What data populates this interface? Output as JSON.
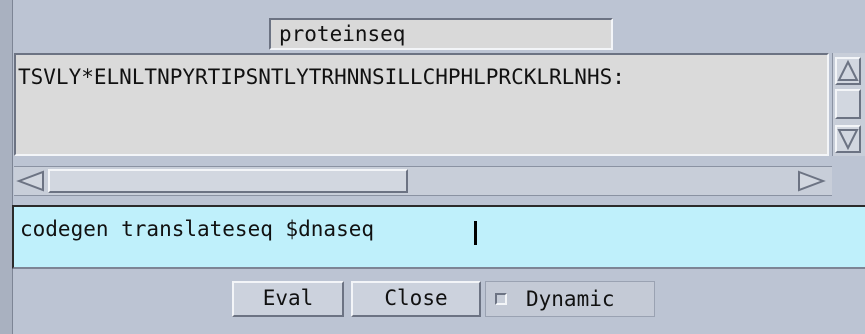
{
  "title_field": {
    "value": "proteinseq"
  },
  "result": {
    "text": "TSVLY*ELNLTNPYRTIPSNTLYTRHNNSILLCHPHLPRCKLRLNHS:"
  },
  "command": {
    "value": "codegen translateseq $dnaseq"
  },
  "buttons": {
    "eval": "Eval",
    "close": "Close"
  },
  "dynamic": {
    "label": "Dynamic",
    "checked": false
  },
  "icons": {
    "scroll_up": "triangle-up-icon",
    "scroll_down": "triangle-down-icon",
    "scroll_left": "triangle-left-icon",
    "scroll_right": "triangle-right-icon"
  },
  "colors": {
    "window_bg": "#bcc4d3",
    "text_area_bg": "#dadada",
    "command_bg": "#bff0fb"
  }
}
